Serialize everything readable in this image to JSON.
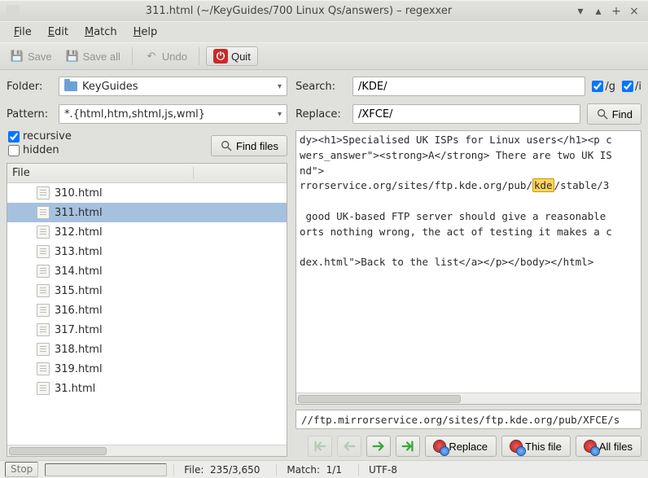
{
  "title": "311.html (~/KeyGuides/700 Linux Qs/answers) – regexxer",
  "menu": {
    "file": "File",
    "edit": "Edit",
    "match": "Match",
    "help": "Help"
  },
  "toolbar": {
    "save": "Save",
    "save_all": "Save all",
    "undo": "Undo",
    "quit": "Quit"
  },
  "left": {
    "folder_label": "Folder:",
    "folder_value": "KeyGuides",
    "pattern_label": "Pattern:",
    "pattern_value": "*.{html,htm,shtml,js,wml}",
    "recursive_label": "recursive",
    "recursive_checked": true,
    "hidden_label": "hidden",
    "hidden_checked": false,
    "find_files_label": "Find files",
    "file_header": "File",
    "files": [
      "310.html",
      "311.html",
      "312.html",
      "313.html",
      "314.html",
      "315.html",
      "316.html",
      "317.html",
      "318.html",
      "319.html",
      "31.html"
    ],
    "selected_index": 1
  },
  "right": {
    "search_label": "Search:",
    "search_value": "/KDE/",
    "g_label": "/g",
    "g_checked": true,
    "i_label": "/i",
    "i_checked": true,
    "replace_label": "Replace:",
    "replace_value": "/XFCE/",
    "find_label": "Find",
    "content_pre": "dy><h1>Specialised UK ISPs for Linux users</h1><p c\nwers_answer\"><strong>A</strong> There are two UK IS\nnd\">\nrrorservice.org/sites/ftp.kde.org/pub/",
    "content_hl": "kde",
    "content_post": "/stable/3\n\n good UK-based FTP server should give a reasonable \norts nothing wrong, the act of testing it makes a c\n\ndex.html\">Back to the list</a></p></body></html>",
    "path_value": "//ftp.mirrorservice.org/sites/ftp.kde.org/pub/XFCE/s",
    "replace_btn": "Replace",
    "this_file_btn": "This file",
    "all_files_btn": "All files"
  },
  "status": {
    "stop": "Stop",
    "file_label": "File:",
    "file_value": "235/3,650",
    "match_label": "Match:",
    "match_value": "1/1",
    "encoding": "UTF-8"
  }
}
